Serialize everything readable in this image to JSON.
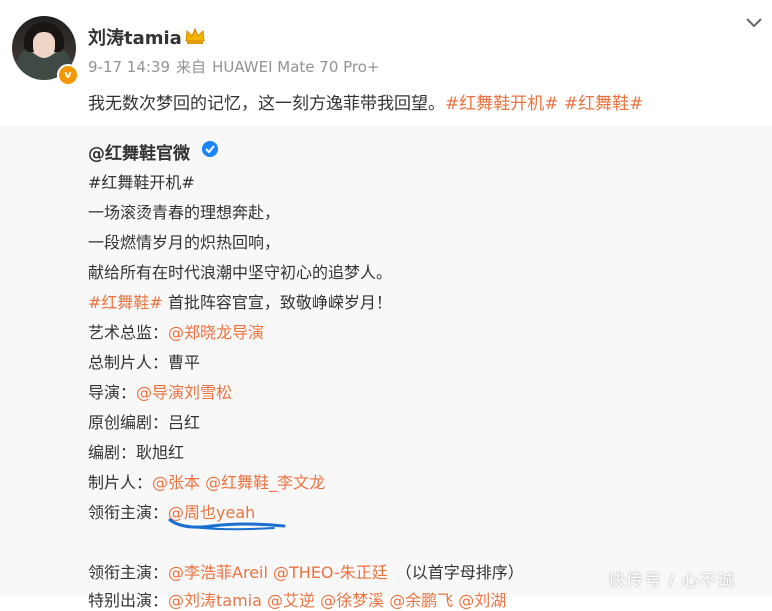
{
  "post": {
    "author": "刘涛tamia",
    "vip_badge": "v",
    "time": "9-17 14:39",
    "source_prefix": "来自",
    "device": "HUAWEI Mate 70 Pro+",
    "text": "我无数次梦回的记忆，这一刻方逸菲带我回望。",
    "hashtags": [
      "#红舞鞋开机#",
      "#红舞鞋#"
    ]
  },
  "repost": {
    "author": "@红舞鞋官微",
    "hashtag_line": "#红舞鞋开机#",
    "lines": [
      "一场滚烫青春的理想奔赴，",
      "一段燃情岁月的炽热回响，",
      "献给所有在时代浪潮中坚守初心的追梦人。"
    ],
    "announce_tag": "#红舞鞋#",
    "announce_text": " 首批阵容官宣，致敬峥嵘岁月！",
    "credits": [
      {
        "label": "艺术总监：",
        "value": "@郑晓龙导演",
        "link": true
      },
      {
        "label": "总制片人：",
        "value": "曹平",
        "link": false
      },
      {
        "label": "导演：",
        "value": "@导演刘雪松",
        "link": true
      },
      {
        "label": "原创编剧：",
        "value": "吕红",
        "link": false
      },
      {
        "label": "编剧：",
        "value": "耿旭红",
        "link": false
      },
      {
        "label": "制片人：",
        "value": "@张本 @红舞鞋_李文龙",
        "link": true
      },
      {
        "label": "领衔主演：",
        "value": "@周也yeah",
        "link": true
      }
    ],
    "cast2": {
      "label": "领衔主演：",
      "value": "@李浩菲Areil @THEO-朱正廷",
      "note": "（以首字母排序）"
    },
    "cut_line": {
      "label": "特别出演：",
      "value": "@刘涛tamia @艾逆 @徐梦溪 @余鹏飞 @刘湖"
    }
  },
  "watermark": "快传号 / 心不诚",
  "colors": {
    "link": "#eb7340",
    "text": "#333333",
    "meta": "#939393",
    "scribble": "#1a6fd0"
  }
}
